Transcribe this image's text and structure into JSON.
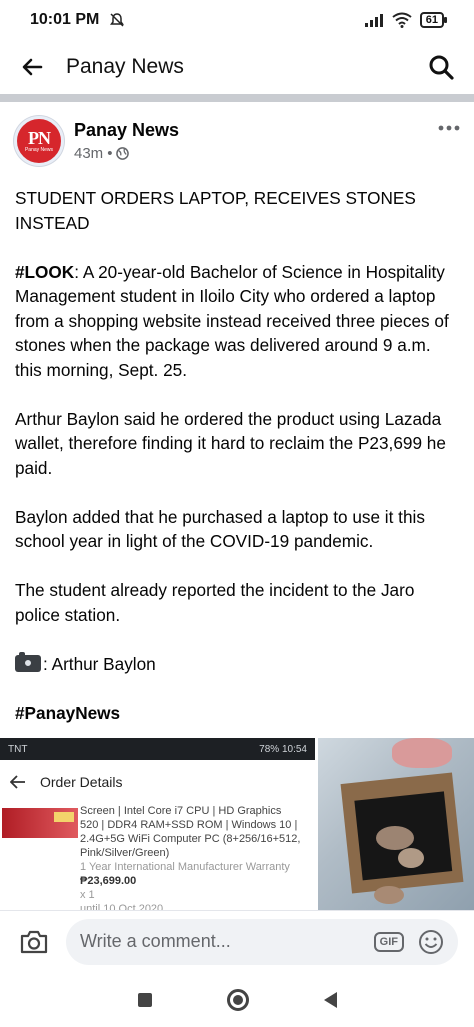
{
  "status_bar": {
    "time": "10:01 PM",
    "battery": "61"
  },
  "header": {
    "title": "Panay News"
  },
  "post": {
    "page_name": "Panay News",
    "avatar_text": "PN",
    "avatar_subtext": "Panay News",
    "time": "43m",
    "separator": "•",
    "headline": "STUDENT ORDERS LAPTOP, RECEIVES STONES INSTEAD",
    "p1_tag": "#LOOK",
    "p1_text": ": A 20-year-old Bachelor of Science in Hospitality Management student in Iloilo City who ordered a laptop from a shopping website instead received three pieces of stones when the package was delivered around 9 a.m. this morning, Sept. 25.",
    "p2": "Arthur Baylon said he ordered the product using Lazada wallet, therefore finding it hard to reclaim the P23,699 he paid.",
    "p3": "Baylon added that he purchased a laptop to use it this school year in light of the COVID-19 pandemic.",
    "p4": "The student already reported the incident to the Jaro police station.",
    "photo_credit": ": Arthur Baylon",
    "hashtag": "#PanayNews"
  },
  "screenshot_image": {
    "status_left": "TNT",
    "status_right": "78%  10:54",
    "title": "Order Details",
    "line1": "Screen | Intel Core i7 CPU | HD Graphics",
    "line2": "520 | DDR4 RAM+SSD ROM | Windows 10 |",
    "line3": "2.4G+5G WiFi Computer PC (8+256/16+512,",
    "line4": "Pink/Silver/Green)",
    "warranty": "1 Year International Manufacturer Warranty",
    "price": "₱23,699.00",
    "qty": "x 1",
    "until": "until 10 Oct 2020"
  },
  "comment_bar": {
    "placeholder": "Write a comment...",
    "gif_label": "GIF"
  }
}
